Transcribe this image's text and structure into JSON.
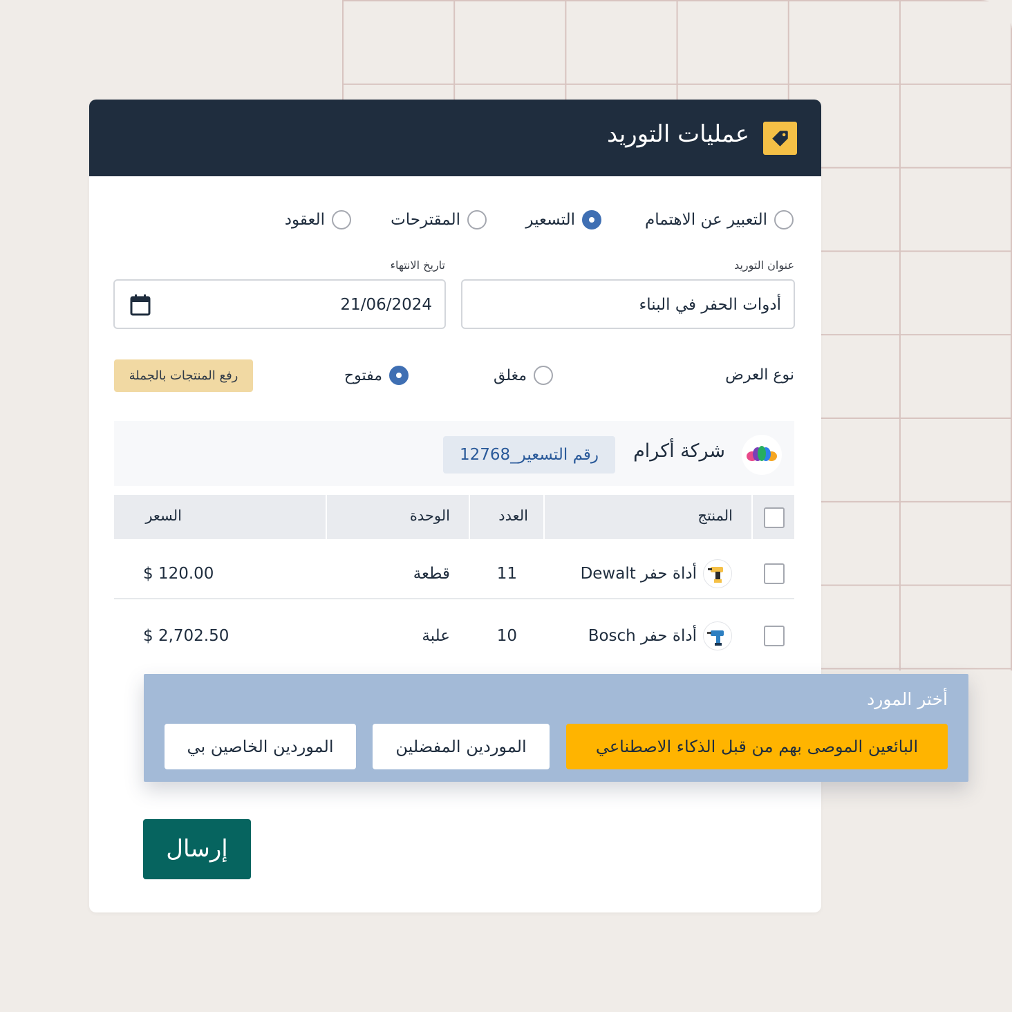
{
  "header": {
    "title": "عمليات التوريد",
    "icon": "tag-icon",
    "accent": "#f5c046",
    "bg": "#1f2d3e"
  },
  "types": [
    {
      "label": "التعبير عن الاهتمام",
      "selected": false
    },
    {
      "label": "التسعير",
      "selected": true
    },
    {
      "label": "المقترحات",
      "selected": false
    },
    {
      "label": "العقود",
      "selected": false
    }
  ],
  "form": {
    "title_label": "عنوان التوريد",
    "title_value": "أدوات الحفر في البناء",
    "expiry_label": "تاريخ الانتهاء",
    "expiry_value": "21/06/2024",
    "offer_type_label": "نوع العرض",
    "offer_closed": "مغلق",
    "offer_open": "مفتوح",
    "offer_selected": "مفتوح",
    "bulk_upload": "رفع المنتجات بالجملة"
  },
  "vendor": {
    "name": "شركة أكرام",
    "quote_ref": "رقم التسعير_12768"
  },
  "table": {
    "headers": {
      "product": "المنتج",
      "qty": "العدد",
      "unit": "الوحدة",
      "price": "السعر"
    },
    "rows": [
      {
        "product": "أداة حفر Dewalt",
        "qty": "11",
        "unit": "قطعة",
        "price": "$ 120.00",
        "icon": "drill-icon"
      },
      {
        "product": "أداة حفر Bosch",
        "qty": "10",
        "unit": "علبة",
        "price": "$ 2,702.50",
        "icon": "drill-icon"
      }
    ]
  },
  "supplier": {
    "title": "أختر المورد",
    "ai": "البائعين الموصى بهم من قبل الذكاء الاصطناعي",
    "preferred": "الموردين المفضلين",
    "mine": "الموردين الخاصين بي"
  },
  "submit": "إرسال"
}
